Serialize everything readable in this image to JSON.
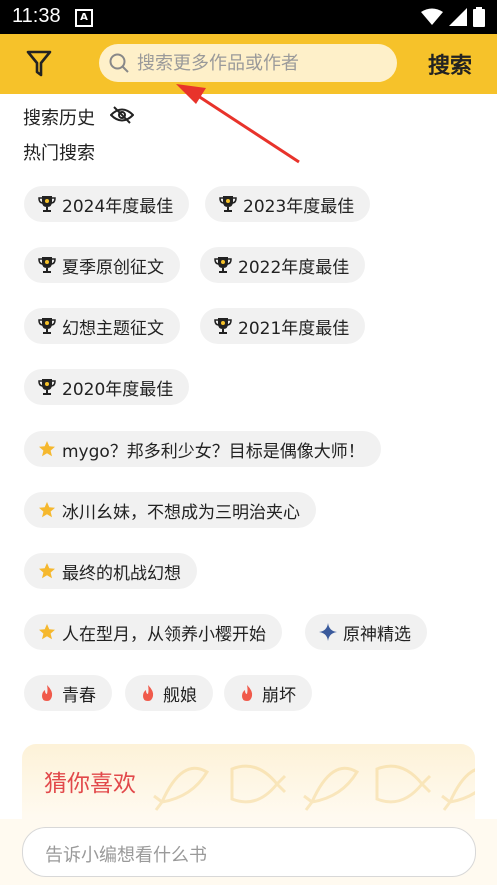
{
  "status": {
    "time": "11:38",
    "notif_letter": "A"
  },
  "header": {
    "search_placeholder": "搜索更多作品或作者",
    "search_button": "搜索"
  },
  "history": {
    "title": "搜索历史"
  },
  "hot": {
    "title": "热门搜索",
    "chips": [
      {
        "label": "2024年度最佳",
        "icon": "trophy-icon"
      },
      {
        "label": "2023年度最佳",
        "icon": "trophy-icon"
      },
      {
        "label": "夏季原创征文",
        "icon": "trophy-icon"
      },
      {
        "label": "2022年度最佳",
        "icon": "trophy-icon"
      },
      {
        "label": "幻想主题征文",
        "icon": "trophy-icon"
      },
      {
        "label": "2021年度最佳",
        "icon": "trophy-icon"
      },
      {
        "label": "2020年度最佳",
        "icon": "trophy-icon"
      },
      {
        "label": "mygo？邦多利少女？目标是偶像大师！",
        "icon": "star-icon"
      },
      {
        "label": "冰川幺妹，不想成为三明治夹心",
        "icon": "star-icon"
      },
      {
        "label": "最终的机战幻想",
        "icon": "star-icon"
      },
      {
        "label": "人在型月，从领养小樱开始",
        "icon": "star-icon"
      },
      {
        "label": "原神精选",
        "icon": "sparkle-icon"
      },
      {
        "label": "青春",
        "icon": "flame-icon"
      },
      {
        "label": "舰娘",
        "icon": "flame-icon"
      },
      {
        "label": "崩坏",
        "icon": "flame-icon"
      }
    ]
  },
  "guess": {
    "title": "猜你喜欢"
  },
  "bottom": {
    "placeholder": "告诉小编想看什么书"
  },
  "colors": {
    "accent": "#f6c22a",
    "chip_bg": "#f1f1f1",
    "guess_title": "#e2494b",
    "arrow": "#e8332b"
  }
}
